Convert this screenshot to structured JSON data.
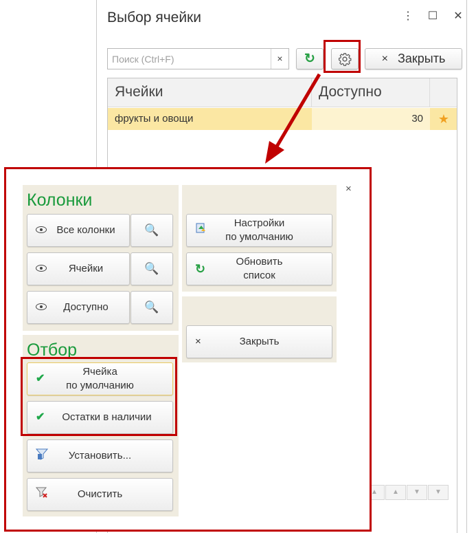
{
  "window": {
    "title": "Выбор ячейки",
    "menu_icon": "more-vert-icon",
    "maximize_icon": "maximize-icon",
    "close_icon": "close-icon"
  },
  "toolbar": {
    "search_placeholder": "Поиск (Ctrl+F)",
    "search_clear": "×",
    "refresh_icon": "↻",
    "gear_icon": "gear-icon",
    "close_x": "×",
    "close_label": "Закрыть"
  },
  "table": {
    "columns": [
      "Ячейки",
      "Доступно",
      ""
    ],
    "rows": [
      {
        "cell": "фрукты и овощи",
        "available": "30",
        "star": "★"
      }
    ]
  },
  "settings": {
    "close_x": "×",
    "columns_title": "Колонки",
    "column_buttons": [
      {
        "label": "Все колонки",
        "search": "🔍"
      },
      {
        "label": "Ячейки",
        "search": "🔍"
      },
      {
        "label": "Доступно",
        "search": "🔍"
      }
    ],
    "defaults_line1": "Настройки",
    "defaults_line2": "по умолчанию",
    "refresh_line1": "Обновить",
    "refresh_line2": "список",
    "refresh_icon": "↻",
    "close_label": "Закрыть",
    "filter_title": "Отбор",
    "filter_default_line1": "Ячейка",
    "filter_default_line2": "по умолчанию",
    "filter_stock": "Остатки в наличии",
    "check": "✔",
    "set_label": "Установить...",
    "clear_label": "Очистить"
  },
  "colors": {
    "accent_green": "#1a9a3c",
    "highlight_red": "#c00000",
    "selected_row": "#fbe7a3",
    "group_bg": "#f0ece0"
  }
}
